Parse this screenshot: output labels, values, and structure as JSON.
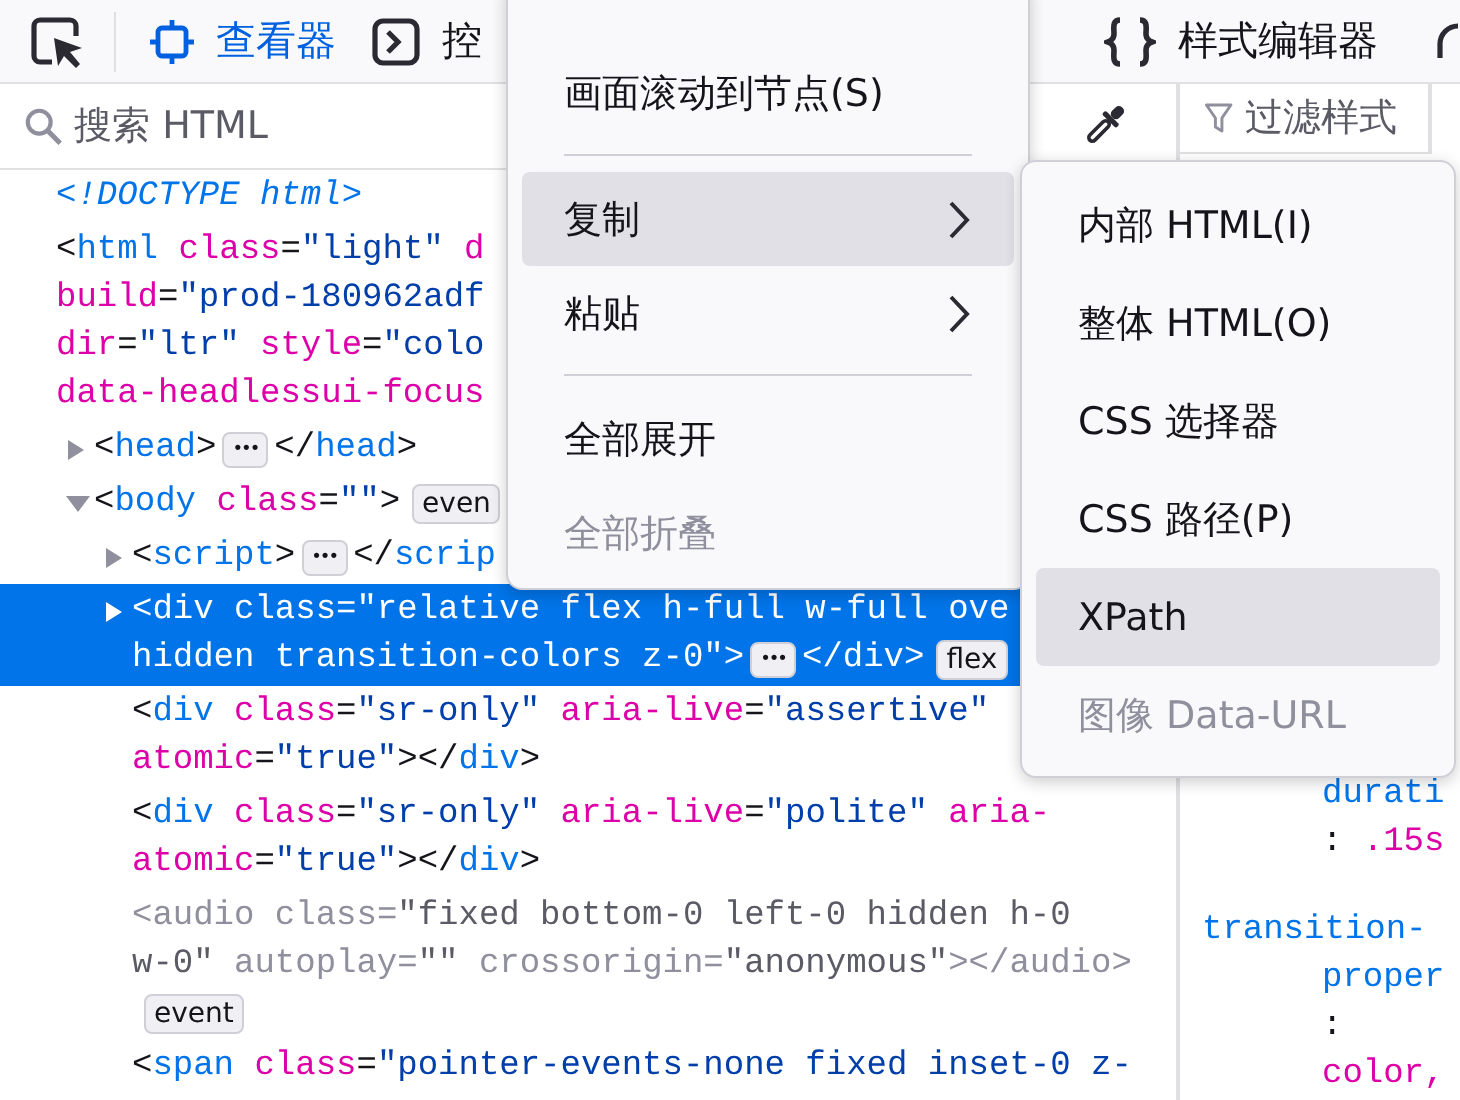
{
  "toolbar": {
    "tabs": [
      {
        "kind": "inspector",
        "label": "查看器",
        "selected": true
      },
      {
        "kind": "console",
        "label": "控",
        "selected": false
      },
      {
        "kind": "style-editor",
        "label": "样式编辑器",
        "selected": false
      }
    ]
  },
  "search": {
    "placeholder": "搜索 HTML"
  },
  "tree": {
    "nodes": [
      {
        "expandable": false,
        "selected": false,
        "hidden": false,
        "lines": [
          [
            {
              "kind": "doctype",
              "text": "<!DOCTYPE html>"
            }
          ]
        ]
      },
      {
        "expandable": false,
        "selected": false,
        "hidden": false,
        "lines": [
          [
            {
              "kind": "punct",
              "text": "<"
            },
            {
              "kind": "tag",
              "text": "html"
            },
            {
              "kind": "attr",
              "text": " class"
            },
            {
              "kind": "punct",
              "text": "="
            },
            {
              "kind": "value",
              "text": "\"light\""
            },
            {
              "kind": "attr",
              "text": " d"
            }
          ],
          [
            {
              "kind": "attr",
              "text": "build"
            },
            {
              "kind": "punct",
              "text": "="
            },
            {
              "kind": "value",
              "text": "\"prod-180962adf"
            }
          ],
          [
            {
              "kind": "attr",
              "text": "dir"
            },
            {
              "kind": "punct",
              "text": "="
            },
            {
              "kind": "value",
              "text": "\"ltr\""
            },
            {
              "kind": "attr",
              "text": " style"
            },
            {
              "kind": "punct",
              "text": "="
            },
            {
              "kind": "value",
              "text": "\"colo"
            }
          ],
          [
            {
              "kind": "attr",
              "text": "data-headlessui-focus"
            }
          ]
        ],
        "children": [
          {
            "expandable": true,
            "expanded": false,
            "selected": false,
            "hidden": false,
            "lines": [
              [
                {
                  "kind": "punct",
                  "text": "<"
                },
                {
                  "kind": "tag",
                  "text": "head"
                },
                {
                  "kind": "punct",
                  "text": ">"
                },
                {
                  "kind": "more",
                  "text": "•••"
                },
                {
                  "kind": "punct",
                  "text": "</"
                },
                {
                  "kind": "tag",
                  "text": "head"
                },
                {
                  "kind": "punct",
                  "text": ">"
                }
              ]
            ]
          },
          {
            "expandable": true,
            "expanded": true,
            "selected": false,
            "hidden": false,
            "lines": [
              [
                {
                  "kind": "punct",
                  "text": "<"
                },
                {
                  "kind": "tag",
                  "text": "body"
                },
                {
                  "kind": "attr",
                  "text": " class"
                },
                {
                  "kind": "punct",
                  "text": "="
                },
                {
                  "kind": "value",
                  "text": "\"\""
                },
                {
                  "kind": "punct",
                  "text": ">"
                },
                {
                  "kind": "badge",
                  "text": "even"
                }
              ]
            ],
            "children": [
              {
                "expandable": true,
                "expanded": false,
                "selected": false,
                "hidden": false,
                "lines": [
                  [
                    {
                      "kind": "punct",
                      "text": "<"
                    },
                    {
                      "kind": "tag",
                      "text": "script"
                    },
                    {
                      "kind": "punct",
                      "text": ">"
                    },
                    {
                      "kind": "more",
                      "text": "•••"
                    },
                    {
                      "kind": "punct",
                      "text": "</"
                    },
                    {
                      "kind": "tag",
                      "text": "scrip"
                    }
                  ]
                ]
              },
              {
                "expandable": true,
                "expanded": false,
                "selected": true,
                "hidden": false,
                "lines": [
                  [
                    {
                      "kind": "punct",
                      "text": "<"
                    },
                    {
                      "kind": "tag",
                      "text": "div"
                    },
                    {
                      "kind": "attr",
                      "text": " class"
                    },
                    {
                      "kind": "punct",
                      "text": "="
                    },
                    {
                      "kind": "value",
                      "text": "\"relative flex h-full w-full ove"
                    }
                  ],
                  [
                    {
                      "kind": "value",
                      "text": "hidden transition-colors z-0\""
                    },
                    {
                      "kind": "punct",
                      "text": ">"
                    },
                    {
                      "kind": "more",
                      "text": "•••"
                    },
                    {
                      "kind": "punct",
                      "text": "</"
                    },
                    {
                      "kind": "tag",
                      "text": "div"
                    },
                    {
                      "kind": "punct",
                      "text": ">"
                    },
                    {
                      "kind": "badge",
                      "text": "flex"
                    }
                  ]
                ]
              },
              {
                "expandable": false,
                "selected": false,
                "hidden": false,
                "lines": [
                  [
                    {
                      "kind": "punct",
                      "text": "<"
                    },
                    {
                      "kind": "tag",
                      "text": "div"
                    },
                    {
                      "kind": "attr",
                      "text": " class"
                    },
                    {
                      "kind": "punct",
                      "text": "="
                    },
                    {
                      "kind": "value",
                      "text": "\"sr-only\""
                    },
                    {
                      "kind": "attr",
                      "text": " aria-live"
                    },
                    {
                      "kind": "punct",
                      "text": "="
                    },
                    {
                      "kind": "value",
                      "text": "\"assertive\""
                    }
                  ],
                  [
                    {
                      "kind": "attr",
                      "text": "atomic"
                    },
                    {
                      "kind": "punct",
                      "text": "="
                    },
                    {
                      "kind": "value",
                      "text": "\"true\""
                    },
                    {
                      "kind": "punct",
                      "text": "></"
                    },
                    {
                      "kind": "tag",
                      "text": "div"
                    },
                    {
                      "kind": "punct",
                      "text": ">"
                    }
                  ]
                ]
              },
              {
                "expandable": false,
                "selected": false,
                "hidden": false,
                "lines": [
                  [
                    {
                      "kind": "punct",
                      "text": "<"
                    },
                    {
                      "kind": "tag",
                      "text": "div"
                    },
                    {
                      "kind": "attr",
                      "text": " class"
                    },
                    {
                      "kind": "punct",
                      "text": "="
                    },
                    {
                      "kind": "value",
                      "text": "\"sr-only\""
                    },
                    {
                      "kind": "attr",
                      "text": " aria-live"
                    },
                    {
                      "kind": "punct",
                      "text": "="
                    },
                    {
                      "kind": "value",
                      "text": "\"polite\""
                    },
                    {
                      "kind": "attr",
                      "text": " aria-"
                    }
                  ],
                  [
                    {
                      "kind": "attr",
                      "text": "atomic"
                    },
                    {
                      "kind": "punct",
                      "text": "="
                    },
                    {
                      "kind": "value",
                      "text": "\"true\""
                    },
                    {
                      "kind": "punct",
                      "text": "></"
                    },
                    {
                      "kind": "tag",
                      "text": "div"
                    },
                    {
                      "kind": "punct",
                      "text": ">"
                    }
                  ]
                ]
              },
              {
                "expandable": false,
                "selected": false,
                "hidden": true,
                "lines": [
                  [
                    {
                      "kind": "punct",
                      "text": "<"
                    },
                    {
                      "kind": "tag",
                      "text": "audio"
                    },
                    {
                      "kind": "attr",
                      "text": " class"
                    },
                    {
                      "kind": "punct",
                      "text": "="
                    },
                    {
                      "kind": "value",
                      "text": "\"fixed bottom-0 left-0 hidden h-0"
                    }
                  ],
                  [
                    {
                      "kind": "value",
                      "text": "w-0\""
                    },
                    {
                      "kind": "attr",
                      "text": " autoplay"
                    },
                    {
                      "kind": "punct",
                      "text": "="
                    },
                    {
                      "kind": "value",
                      "text": "\"\""
                    },
                    {
                      "kind": "attr",
                      "text": " crossorigin"
                    },
                    {
                      "kind": "punct",
                      "text": "="
                    },
                    {
                      "kind": "value",
                      "text": "\"anonymous\""
                    },
                    {
                      "kind": "punct",
                      "text": "></"
                    },
                    {
                      "kind": "tag",
                      "text": "audio"
                    },
                    {
                      "kind": "punct",
                      "text": ">"
                    }
                  ],
                  [
                    {
                      "kind": "badge",
                      "text": "event"
                    }
                  ]
                ]
              },
              {
                "expandable": false,
                "selected": false,
                "hidden": false,
                "lines": [
                  [
                    {
                      "kind": "punct",
                      "text": "<"
                    },
                    {
                      "kind": "tag",
                      "text": "span"
                    },
                    {
                      "kind": "attr",
                      "text": " class"
                    },
                    {
                      "kind": "punct",
                      "text": "="
                    },
                    {
                      "kind": "value",
                      "text": "\"pointer-events-none fixed inset-0 z-"
                    }
                  ]
                ]
              }
            ]
          }
        ]
      }
    ]
  },
  "rules": {
    "filter_placeholder": "过滤样式",
    "lines": [
      {
        "indented": true,
        "segments": [
          {
            "kind": "prop",
            "text": "durati"
          }
        ]
      },
      {
        "indented": true,
        "segments": [
          {
            "kind": "punct",
            "text": ": "
          },
          {
            "kind": "value",
            "text": ".15s"
          }
        ]
      },
      {
        "indented": false,
        "segments": [
          {
            "kind": "prop",
            "text": "transition-"
          }
        ]
      },
      {
        "indented": true,
        "segments": [
          {
            "kind": "prop",
            "text": "proper"
          }
        ]
      },
      {
        "indented": true,
        "segments": [
          {
            "kind": "punct",
            "text": ":"
          }
        ]
      },
      {
        "indented": true,
        "segments": [
          {
            "kind": "value",
            "text": "color,"
          }
        ]
      }
    ]
  },
  "context_menu": {
    "items": [
      {
        "kind": "item",
        "label": "画面滚动到节点(S)",
        "selected": false,
        "disabled": false,
        "submenu": false
      },
      {
        "kind": "separator"
      },
      {
        "kind": "item",
        "label": "复制",
        "selected": true,
        "disabled": false,
        "submenu": true
      },
      {
        "kind": "item",
        "label": "粘贴",
        "selected": false,
        "disabled": false,
        "submenu": true
      },
      {
        "kind": "separator"
      },
      {
        "kind": "item",
        "label": "全部展开",
        "selected": false,
        "disabled": false,
        "submenu": false
      },
      {
        "kind": "item",
        "label": "全部折叠",
        "selected": false,
        "disabled": true,
        "submenu": false
      }
    ]
  },
  "submenu": {
    "items": [
      {
        "label": "内部 HTML(I)",
        "selected": false,
        "disabled": false
      },
      {
        "label": "整体 HTML(O)",
        "selected": false,
        "disabled": false
      },
      {
        "label": "CSS 选择器",
        "selected": false,
        "disabled": false
      },
      {
        "label": "CSS 路径(P)",
        "selected": false,
        "disabled": false
      },
      {
        "label": "XPath",
        "selected": true,
        "disabled": false
      },
      {
        "label": "图像 Data-URL",
        "selected": false,
        "disabled": true
      }
    ]
  }
}
